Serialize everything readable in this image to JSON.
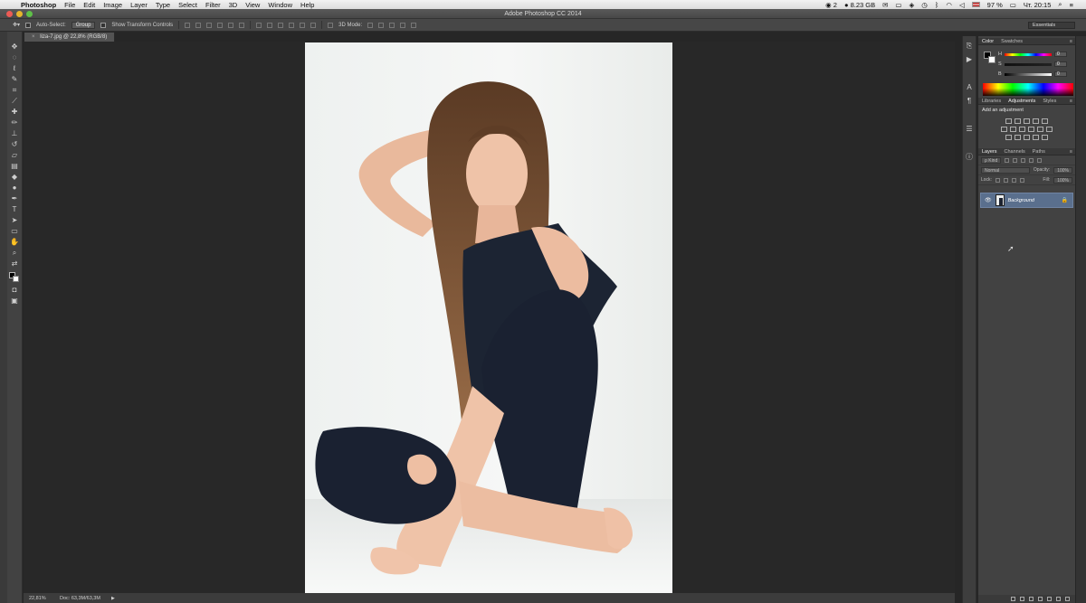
{
  "menubar": {
    "app": "Photoshop",
    "items": [
      "File",
      "Edit",
      "Image",
      "Layer",
      "Type",
      "Select",
      "Filter",
      "3D",
      "View",
      "Window",
      "Help"
    ],
    "status": {
      "notifications": "2",
      "disk": "8.23 GB",
      "battery": "97 %",
      "clock": "Чт. 20:15"
    }
  },
  "titlebar": {
    "title": "Adobe Photoshop CC 2014"
  },
  "options": {
    "auto_select_label": "Auto-Select:",
    "auto_select_value": "Group",
    "show_transform_label": "Show Transform Controls",
    "mode_3d": "3D Mode:",
    "workspace": "Essentials"
  },
  "document": {
    "tab_label": "liza-7.jpg @ 22,8% (RGB/8)",
    "close": "×"
  },
  "status": {
    "zoom": "22,81%",
    "doc": "Doc: 63,3M/63,3M",
    "arrow": "▶"
  },
  "color_panel": {
    "tabs": [
      "Color",
      "Swatches"
    ],
    "sliders": [
      {
        "label": "H",
        "value": "0"
      },
      {
        "label": "S",
        "value": "0"
      },
      {
        "label": "B",
        "value": "0"
      }
    ]
  },
  "adjustments_panel": {
    "tabs": [
      "Libraries",
      "Adjustments",
      "Styles"
    ],
    "title": "Add an adjustment"
  },
  "layers_panel": {
    "tabs": [
      "Layers",
      "Channels",
      "Paths"
    ],
    "kind": "ρ Kind",
    "blend": "Normal",
    "opacity_label": "Opacity:",
    "opacity_value": "100%",
    "lock_label": "Lock:",
    "fill_label": "Fill:",
    "fill_value": "100%",
    "layers": [
      {
        "name": "Background",
        "visible": true,
        "locked": true
      }
    ]
  },
  "colors": {
    "ui_dark": "#262626",
    "panel": "#424242",
    "selected_layer": "#5a6f8d",
    "fg_color": "#000000",
    "bg_color": "#ffffff"
  }
}
